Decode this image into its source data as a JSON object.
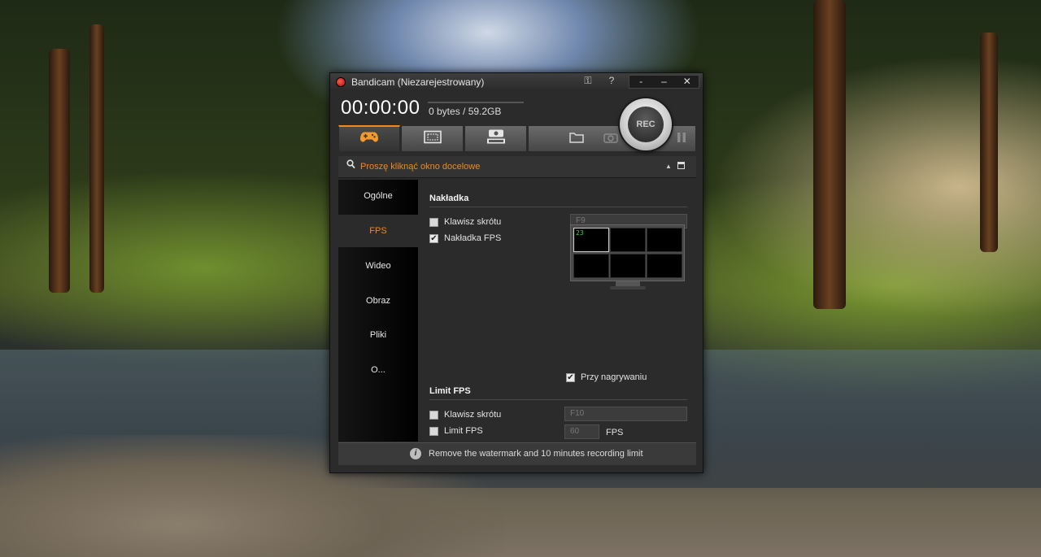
{
  "window": {
    "title": "Bandicam (Niezarejestrowany)",
    "controls": {
      "key": "⚿",
      "help": "?",
      "minimize_mini": "-",
      "minimize": "‒",
      "close": "✕"
    }
  },
  "status": {
    "timer": "00:00:00",
    "size": "0 bytes / 59.2GB"
  },
  "rec_button": {
    "label": "REC"
  },
  "tabs": [
    {
      "name": "game-mode",
      "icon": "gamepad-icon"
    },
    {
      "name": "screen-mode",
      "icon": "screen-rectangle-icon"
    },
    {
      "name": "device-mode",
      "icon": "hdmi-icon"
    }
  ],
  "toolbar_icons": [
    "folder-icon",
    "camera-icon",
    "pause-icon"
  ],
  "target": {
    "text": "Proszę kliknąć okno docelowe"
  },
  "sidebar": {
    "items": [
      {
        "label": "Ogólne"
      },
      {
        "label": "FPS"
      },
      {
        "label": "Wideo"
      },
      {
        "label": "Obraz"
      },
      {
        "label": "Pliki"
      },
      {
        "label": "O..."
      }
    ],
    "active": "FPS"
  },
  "overlay": {
    "heading": "Nakładka",
    "hotkey_label": "Klawisz skrótu",
    "hotkey_checked": false,
    "hotkey_value": "F9",
    "fps_overlay_label": "Nakładka FPS",
    "fps_overlay_checked": true,
    "preview_fps": "23"
  },
  "limit": {
    "heading": "Limit FPS",
    "hotkey_label": "Klawisz skrótu",
    "hotkey_checked": false,
    "hotkey_value": "F10",
    "limit_label": "Limit FPS",
    "limit_checked": false,
    "limit_value": "60",
    "unit": "FPS",
    "recording_label": "Przy nagrywaniu",
    "recording_checked": true
  },
  "footer": {
    "text": "Remove the watermark and 10 minutes recording limit"
  }
}
